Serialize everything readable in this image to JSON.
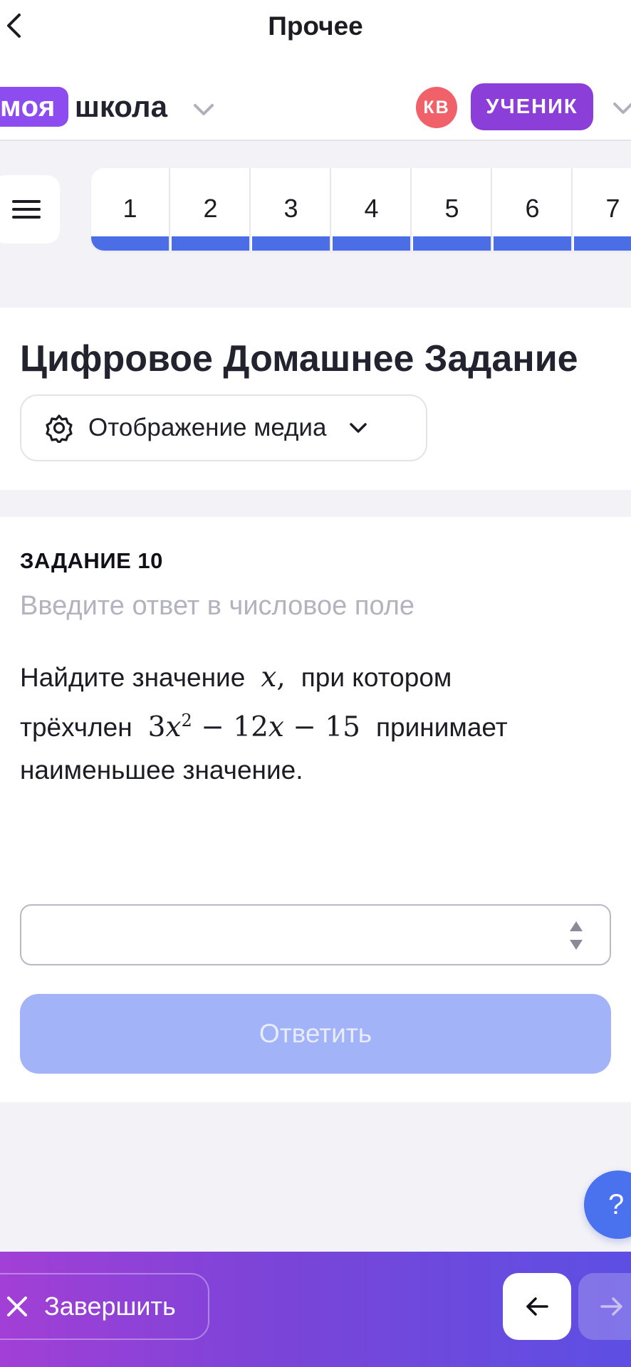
{
  "nav": {
    "title": "Прочее"
  },
  "logo": {
    "part1": "моя",
    "part2": "школа"
  },
  "user": {
    "initials": "КВ",
    "role": "УЧЕНИК"
  },
  "tasks": [
    {
      "label": "1"
    },
    {
      "label": "2"
    },
    {
      "label": "3"
    },
    {
      "label": "4"
    },
    {
      "label": "5"
    },
    {
      "label": "6"
    },
    {
      "label": "7"
    }
  ],
  "header": {
    "title": "Цифровое Домашнее Задание",
    "media_label": "Отображение медиа"
  },
  "task": {
    "label": "ЗАДАНИЕ 10",
    "hint": "Введите ответ в числовое поле",
    "text_1": "Найдите значение",
    "text_2": "при котором",
    "text_3": "трёхчлен",
    "text_4": "принимает",
    "text_5": "наименьшее значение.",
    "variable": "x",
    "formula_coef": "3",
    "formula_var": "x",
    "formula_exp": "2",
    "formula_rest": "− 12",
    "formula_var2": "x",
    "formula_tail": "− 15",
    "answer_value": "",
    "submit_label": "Ответить"
  },
  "help": {
    "label": "?"
  },
  "footer": {
    "finish_label": "Завершить"
  },
  "colors": {
    "accent_purple": "#8c3fd8",
    "progress_blue": "#4b6de6",
    "submit_disabled": "#a3b3f7",
    "avatar_red": "#f0616a"
  },
  "icons": [
    "back-arrow-icon",
    "chevron-down-icon",
    "menu-icon",
    "gear-icon",
    "spinner-icon",
    "close-icon",
    "arrow-left-icon",
    "arrow-right-icon"
  ]
}
